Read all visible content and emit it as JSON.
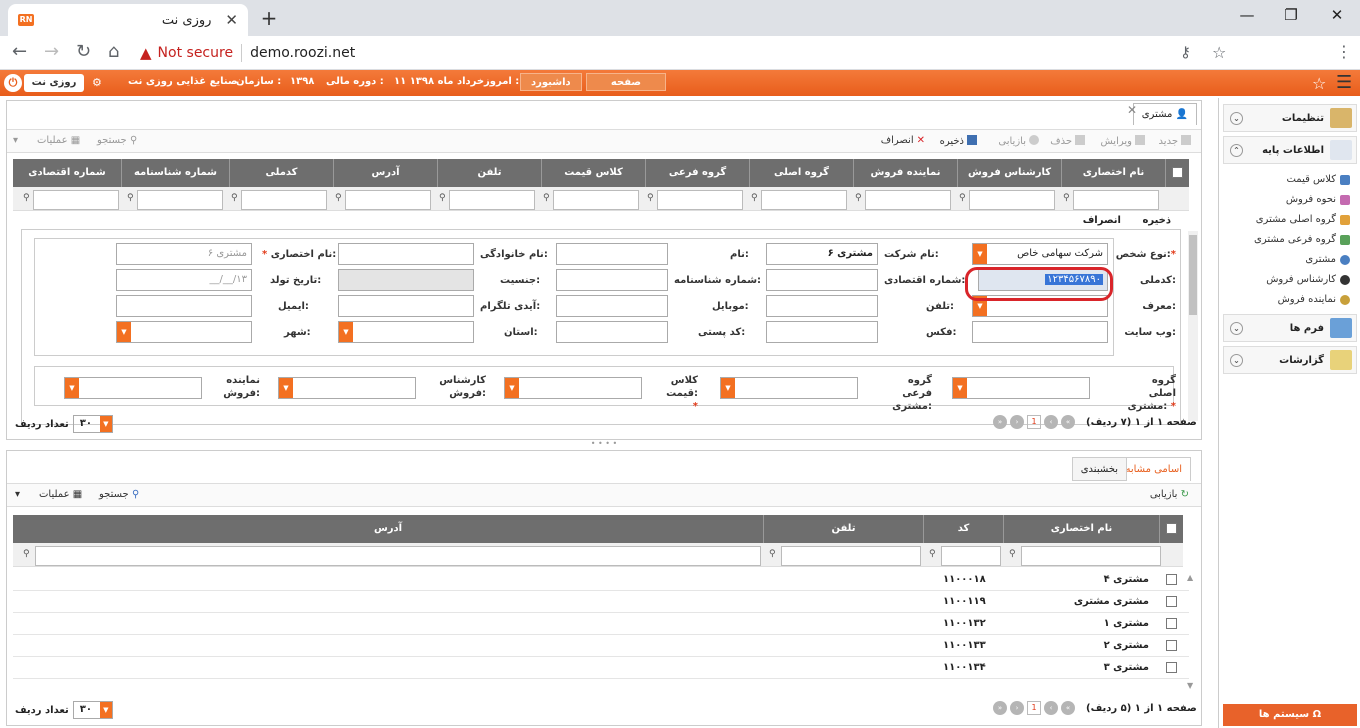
{
  "browser": {
    "tab_title": "روزی نت",
    "favicon_text": "RN",
    "new_tab": "+",
    "not_secure": "Not secure",
    "url": "demo.roozi.net"
  },
  "header": {
    "logo": "روزی نت",
    "org_label": "سازمان :",
    "org_value": "صنایع غذایی روزی نت",
    "fiscal_label": "دوره مالی :",
    "fiscal_value": "۱۳۹۸",
    "today_label": "امروز :",
    "today_value": "۱۱ خرداد ماه ۱۳۹۸",
    "dashboard": "داشبورد",
    "home": "صفحه نخست"
  },
  "sidebar": {
    "settings": "تنظیمات",
    "base_info": "اطلاعات پایه",
    "items": [
      "کلاس قیمت",
      "نحوه فروش",
      "گروه اصلی مشتری",
      "گروه فرعی مشتری",
      "مشتری",
      "کارشناس فروش",
      "نماینده فروش"
    ],
    "forms": "فرم ها",
    "reports": "گزارشات",
    "system": "سیستم ها"
  },
  "main": {
    "tab": "مشتری",
    "toolbar": {
      "new": "جدید",
      "edit": "ویرایش",
      "delete": "حذف",
      "restore": "بازیابی",
      "save": "ذخیره",
      "cancel": "انصراف",
      "search": "جستجو",
      "operations": "عملیات"
    },
    "columns": [
      "نام اختصاری",
      "کارشناس فروش",
      "نماینده فروش",
      "گروه اصلی",
      "گروه فرعی",
      "کلاس قیمت",
      "تلفن",
      "آدرس",
      "کدملی",
      "شماره شناسنامه",
      "شماره اقتصادی"
    ],
    "form_actions": {
      "save": "ذخیره",
      "cancel": "انصراف"
    },
    "form": {
      "person_type_label": "نوع شخص:",
      "person_type_value": "شرکت سهامی خاص",
      "company_label": "نام شرکت:",
      "company_value": "مشتری ۶",
      "first_name_label": "نام:",
      "family_label": "نام خانوادگی:",
      "short_name_label": "نام اختصاری:",
      "short_name_placeholder": "مشتری ۶",
      "national_code_label": "کدملی:",
      "national_code_value": "۱۲۳۴۵۶۷۸۹۰",
      "economic_label": "شماره اقتصادی:",
      "id_number_label": "شماره شناسنامه:",
      "gender_label": "جنسیت:",
      "birth_label": "تاریخ تولد:",
      "birth_placeholder": "__/__/۱۳",
      "referrer_label": "معرف:",
      "phone_label": "تلفن:",
      "mobile_label": "موبایل:",
      "telegram_label": "آیدی تلگرام:",
      "email_label": "ایمیل:",
      "website_label": "وب سایت:",
      "fax_label": "فکس:",
      "postal_label": "کد پستی:",
      "province_label": "استان:",
      "city_label": "شهر:",
      "main_group_label": "گروه اصلی مشتری:",
      "sub_group_label": "گروه فرعی مشتری:",
      "price_class_label": "کلاس قیمت:",
      "sales_expert_label": "کارشناس فروش:",
      "sales_rep_label": "نماینده فروش:"
    },
    "pager": {
      "text": "صفحه ۱ از ۱ (۷ ردیف)",
      "page": "1",
      "rows_label": "تعداد ردیف",
      "rows_value": "۳۰"
    }
  },
  "bottom": {
    "tabs": [
      "اسامی مشابه",
      "بخشبندی"
    ],
    "toolbar": {
      "restore": "بازیابی",
      "search": "جستجو",
      "operations": "عملیات"
    },
    "columns": [
      "نام اختصاری",
      "کد",
      "تلفن",
      "آدرس"
    ],
    "rows": [
      {
        "name": "مشتری ۴",
        "code": "۱۱۰۰۰۱۸"
      },
      {
        "name": "مشتری مشتری",
        "code": "۱۱۰۰۱۱۹"
      },
      {
        "name": "مشتری ۱",
        "code": "۱۱۰۰۱۳۲"
      },
      {
        "name": "مشتری ۲",
        "code": "۱۱۰۰۱۳۳"
      },
      {
        "name": "مشتری ۳",
        "code": "۱۱۰۰۱۳۴"
      }
    ],
    "pager": {
      "text": "صفحه ۱ از ۱ (۵ ردیف)",
      "page": "1",
      "rows_label": "تعداد ردیف",
      "rows_value": "۳۰"
    }
  },
  "colors": {
    "accent": "#e85d1b",
    "header_grid": "#6e6e6e",
    "highlight": "#d9252a"
  }
}
